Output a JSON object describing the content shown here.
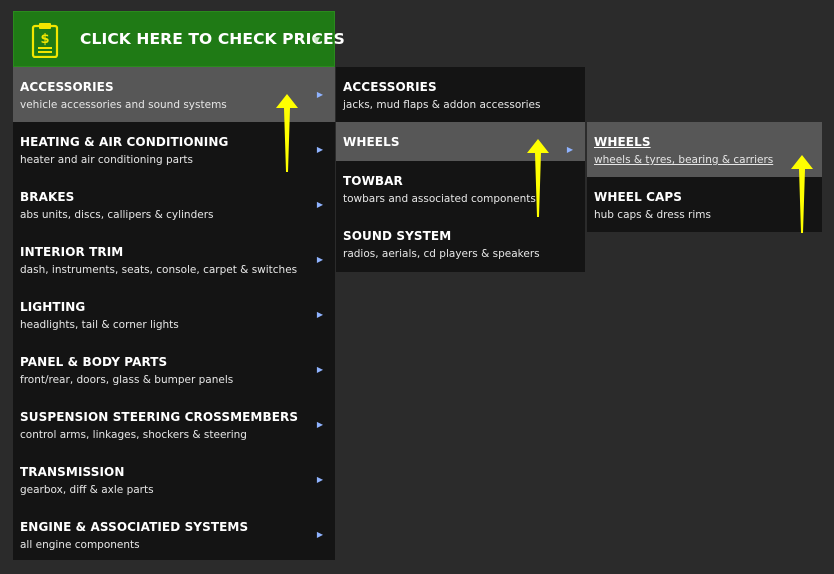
{
  "header": {
    "title": "CLICK HERE TO CHECK PRICES"
  },
  "menu_level1": [
    {
      "label": "ACCESSORIES",
      "sub": "vehicle accessories and sound systems"
    },
    {
      "label": "HEATING & AIR CONDITIONING",
      "sub": "heater and air conditioning parts"
    },
    {
      "label": "BRAKES",
      "sub": "abs units, discs, callipers & cylinders"
    },
    {
      "label": "INTERIOR TRIM",
      "sub": "dash, instruments, seats, console, carpet & switches"
    },
    {
      "label": "LIGHTING",
      "sub": "headlights, tail & corner lights"
    },
    {
      "label": "PANEL & BODY PARTS",
      "sub": "front/rear, doors, glass & bumper panels"
    },
    {
      "label": "SUSPENSION STEERING CROSSMEMBERS",
      "sub": "control arms, linkages, shockers & steering"
    },
    {
      "label": "TRANSMISSION",
      "sub": "gearbox, diff & axle parts"
    },
    {
      "label": "ENGINE & ASSOCIATIED SYSTEMS",
      "sub": "all engine components"
    }
  ],
  "menu_level2": [
    {
      "label": "ACCESSORIES",
      "sub": "jacks, mud flaps & addon accessories"
    },
    {
      "label": "WHEELS",
      "sub": ""
    },
    {
      "label": "TOWBAR",
      "sub": "towbars and associated components"
    },
    {
      "label": "SOUND SYSTEM",
      "sub": "radios, aerials, cd players & speakers"
    }
  ],
  "menu_level3": [
    {
      "label": "WHEELS",
      "sub": "wheels & tyres, bearing & carriers"
    },
    {
      "label": "WHEEL CAPS",
      "sub": "hub caps & dress rims"
    }
  ],
  "colors": {
    "header_bg": "#1f7a15",
    "menu_bg": "#141414",
    "active_bg": "#575757",
    "arrow": "#8fb3ff",
    "annotation": "#ffff00"
  },
  "icons": {
    "header_icon": "price-clipboard-icon",
    "caret": "caret-down-icon",
    "submenu_arrow": "chevron-right-icon"
  }
}
